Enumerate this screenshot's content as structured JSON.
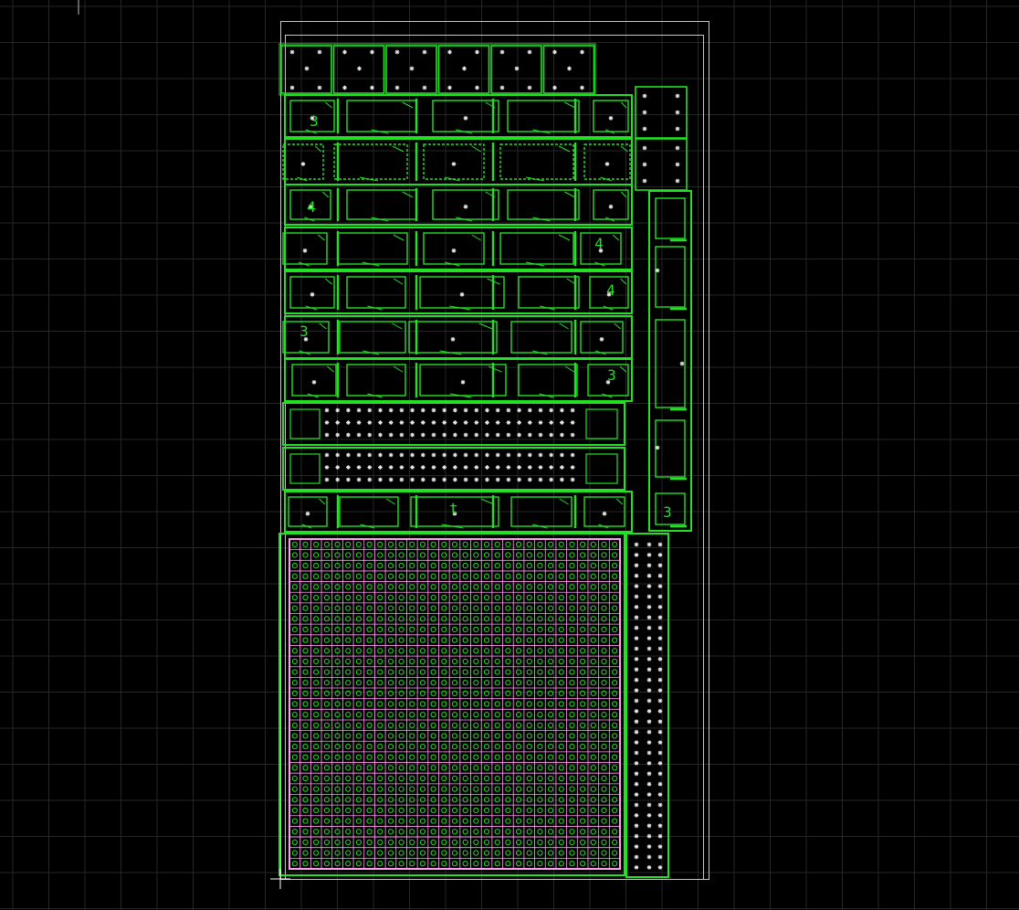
{
  "viewport": {
    "background": "#000000",
    "grid_color": "#262626",
    "frame_color": "#c8c8c8",
    "layout_color": "#22e022",
    "site_color": "#e8e8e8",
    "mesh_color": "#ff9ff0"
  },
  "row_labels": [
    "4",
    "4",
    "4",
    "3",
    "3",
    "3",
    "t",
    "3"
  ],
  "status": {
    "cursor_marker": "crosshair"
  }
}
